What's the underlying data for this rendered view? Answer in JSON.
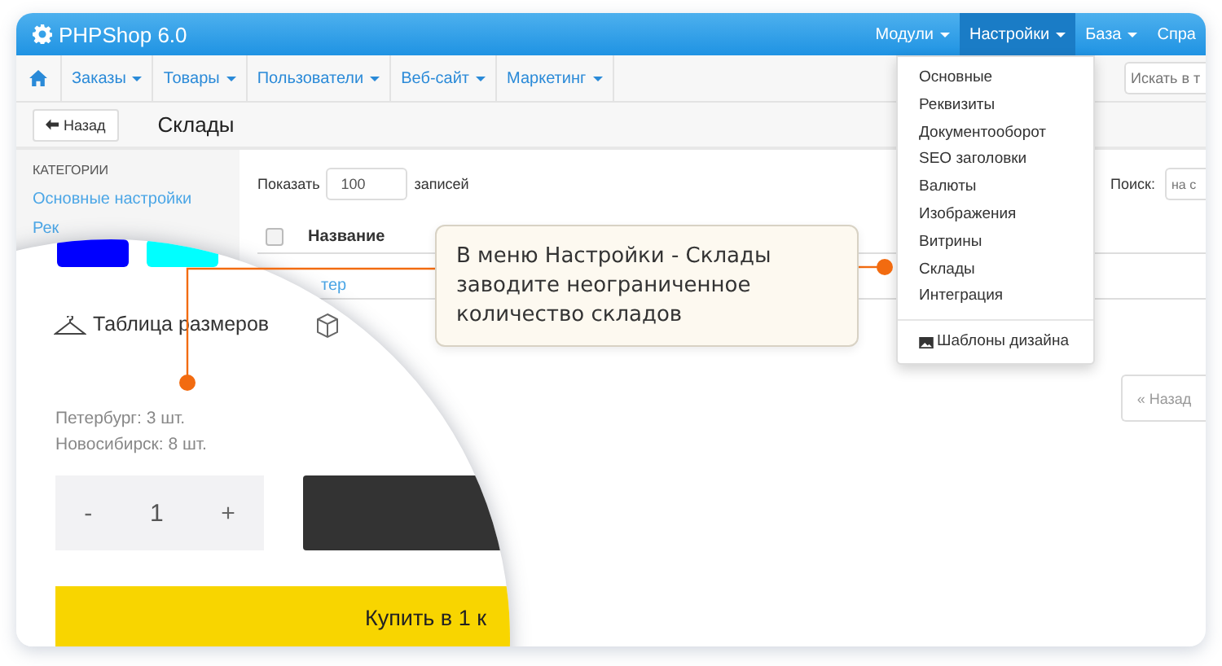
{
  "app": {
    "title": "PHPShop 6.0"
  },
  "top_menu": [
    {
      "label": "Модули",
      "selected": false
    },
    {
      "label": "Настройки",
      "selected": true
    },
    {
      "label": "База",
      "selected": false
    },
    {
      "label": "Спра",
      "selected": false
    }
  ],
  "nav": {
    "items": [
      "Заказы",
      "Товары",
      "Пользователи",
      "Веб-сайт",
      "Маркетинг"
    ],
    "search_placeholder": "Искать в т"
  },
  "toolbar": {
    "back": "Назад",
    "title": "Склады"
  },
  "sidebar": {
    "heading": "КАТЕГОРИИ",
    "items": [
      "Основные настройки",
      "Рек"
    ]
  },
  "table_controls": {
    "show_label": "Показать",
    "page_size": "100",
    "records_label": "записей",
    "search_label": "Поиск:",
    "search_placeholder": "на с"
  },
  "table": {
    "select_all_checked": false,
    "columns": [
      "Название"
    ],
    "rows": [
      "тер"
    ]
  },
  "pager": {
    "prev": "« Назад"
  },
  "dropdown": {
    "items": [
      "Основные",
      "Реквизиты",
      "Документооборот",
      "SEO заголовки",
      "Валюты",
      "Изображения",
      "Витрины",
      "Склады",
      "Интеграция"
    ],
    "footer": "Шаблоны дизайна"
  },
  "callout": {
    "text": "В меню Настройки - Склады заводите неограниченное количество складов"
  },
  "magnifier": {
    "swatches": [
      {
        "color": "#0000ff"
      },
      {
        "color": "#00ffff"
      }
    ],
    "size_table": "Таблица размеров",
    "stock": [
      "Петербург: 3 шт.",
      "Новосибирск: 8 шт."
    ],
    "quantity": {
      "minus": "-",
      "value": "1",
      "plus": "+"
    },
    "buy": "Купить в 1 к"
  }
}
